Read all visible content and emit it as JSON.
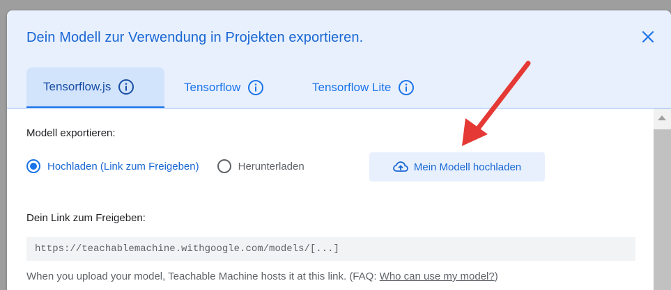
{
  "dialog": {
    "title": "Dein Modell zur Verwendung in Projekten exportieren.",
    "close_icon": "close-icon"
  },
  "tabs": [
    {
      "label": "Tensorflow.js",
      "icon": "info-icon",
      "active": true
    },
    {
      "label": "Tensorflow",
      "icon": "info-icon",
      "active": false
    },
    {
      "label": "Tensorflow Lite",
      "icon": "info-icon",
      "active": false
    }
  ],
  "export": {
    "section_label": "Modell exportieren:",
    "options": [
      {
        "label": "Hochladen (Link zum Freigeben)",
        "selected": true
      },
      {
        "label": "Herunterladen",
        "selected": false
      }
    ],
    "upload_button": {
      "label": "Mein Modell hochladen",
      "icon": "cloud-upload-icon"
    }
  },
  "share": {
    "label": "Dein Link zum Freigeben:",
    "link_value": "https://teachablemachine.withgoogle.com/models/[...]",
    "helper_prefix": "When you upload your model, Teachable Machine hosts it at this link. (FAQ: ",
    "helper_link": "Who can use my model?",
    "helper_suffix": ")"
  },
  "colors": {
    "accent": "#1a73e8",
    "header_bg": "#e8f0fe",
    "annotation_arrow": "#e53935"
  }
}
